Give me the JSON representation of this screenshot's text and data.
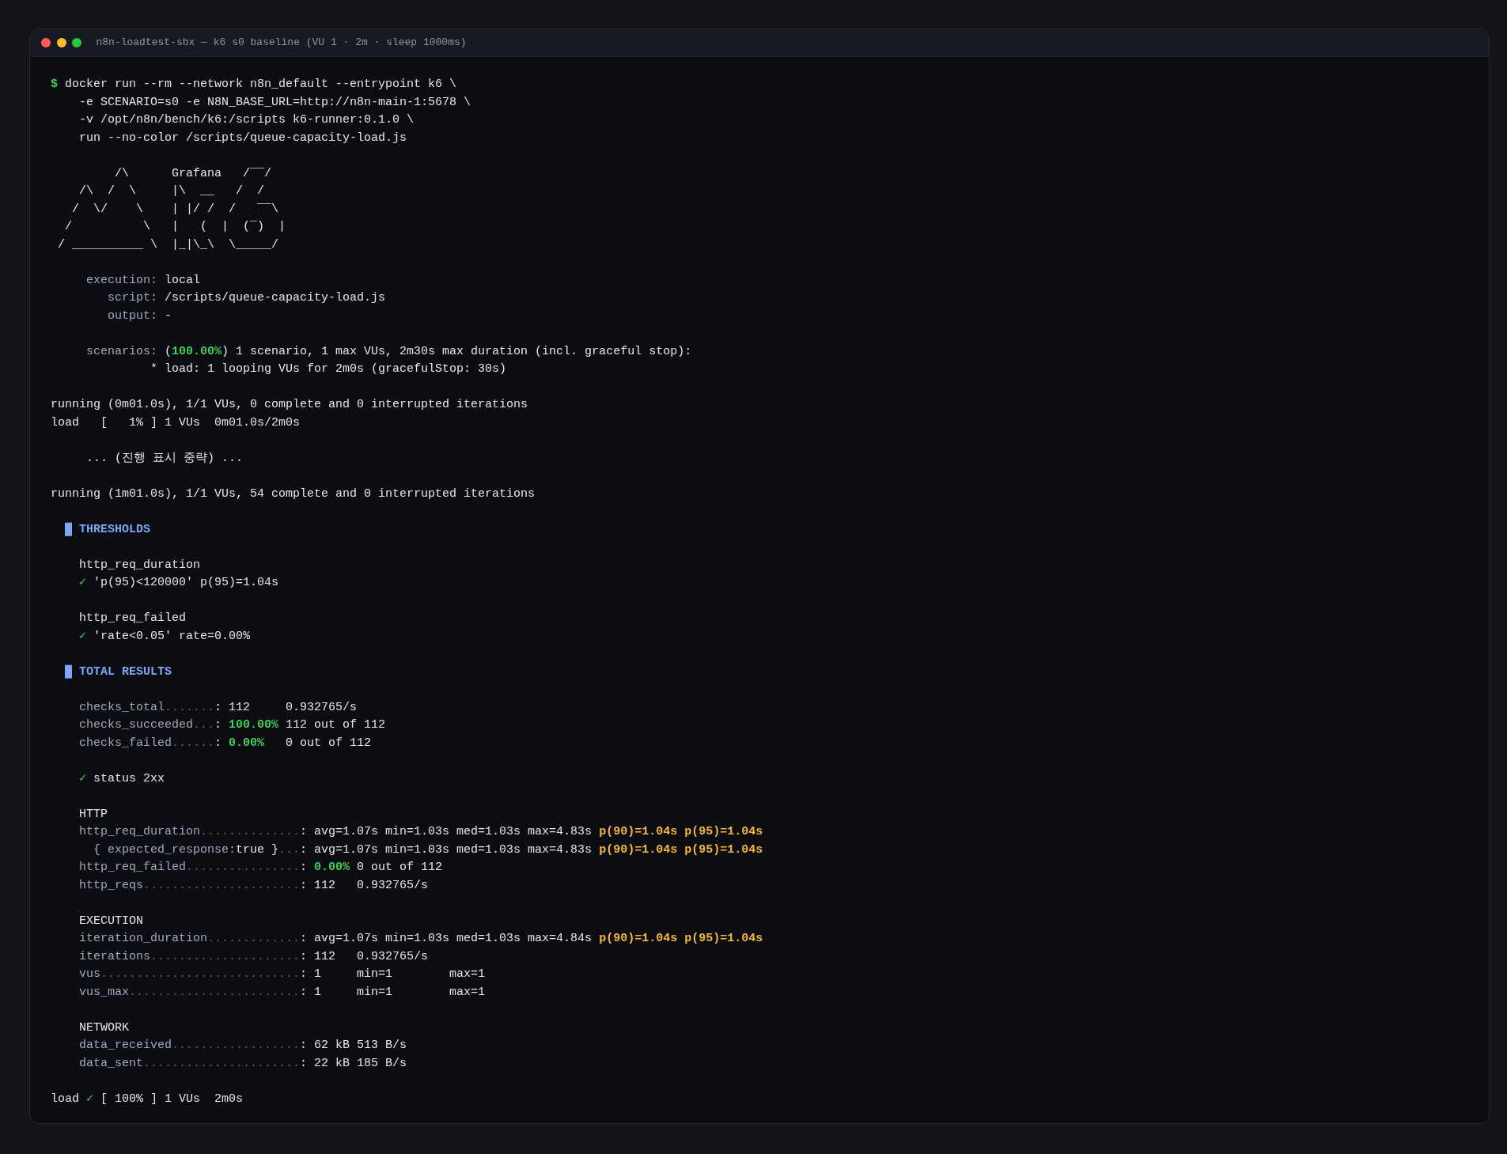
{
  "window": {
    "title": "n8n-loadtest-sbx — k6 s0 baseline (VU 1 · 2m · sleep 1000ms)"
  },
  "terminal": {
    "blocks": [
      {
        "kind": "text",
        "lines": [
          [
            {
              "text": "$",
              "kind": "prompt"
            },
            {
              "text": " docker run --rm --network n8n_default --entrypoint k6 \\",
              "kind": "plain"
            }
          ],
          [
            {
              "text": "    -e SCENARIO=s0 -e N8N_BASE_URL=http://n8n-main-1:5678 \\",
              "kind": "plain"
            }
          ],
          [
            {
              "text": "    -v /opt/n8n/bench/k6:/scripts k6-runner:0.1.0 \\",
              "kind": "plain"
            }
          ],
          [
            {
              "text": "    run --no-color /scripts/queue-capacity-load.js",
              "kind": "plain"
            }
          ]
        ]
      },
      {
        "kind": "art",
        "lines": [
          "         /\\      Grafana   /‾‾/",
          "    /\\  /  \\     |\\  __   /  /",
          "   /  \\/    \\    | |/ /  /   ‾‾\\",
          "  /          \\   |   (  |  (‾)  |",
          " / __________ \\  |_|\\_\\  \\_____/"
        ]
      },
      {
        "kind": "text",
        "lines": [
          [
            {
              "text": "     execution:",
              "kind": "label"
            },
            {
              "text": " local",
              "kind": "plain"
            }
          ],
          [
            {
              "text": "        script:",
              "kind": "label"
            },
            {
              "text": " /scripts/queue-capacity-load.js",
              "kind": "plain"
            }
          ],
          [
            {
              "text": "        output:",
              "kind": "label"
            },
            {
              "text": " -",
              "kind": "plain"
            }
          ]
        ]
      },
      {
        "kind": "text",
        "lines": [
          [
            {
              "text": "     scenarios:",
              "kind": "label"
            },
            {
              "text": " (",
              "kind": "plain"
            },
            {
              "text": "100.00%",
              "kind": "pass"
            },
            {
              "text": ") 1 scenario, 1 max VUs, 2m30s max duration (incl. graceful stop):",
              "kind": "plain"
            }
          ],
          [
            {
              "text": "              * load: 1 looping VUs for 2m0s (gracefulStop: 30s)",
              "kind": "plain"
            }
          ]
        ]
      },
      {
        "kind": "text",
        "lines": [
          [
            {
              "text": "running (0m01.0s), 1/1 VUs, 0 complete and 0 interrupted iterations",
              "kind": "plain"
            }
          ],
          [
            {
              "text": "load   [   1% ] 1 VUs  0m01.0s/2m0s",
              "kind": "plain"
            }
          ]
        ]
      },
      {
        "kind": "text",
        "lines": [
          [
            {
              "text": "     ... (진행 표시 중략) ...",
              "kind": "plain"
            }
          ]
        ]
      },
      {
        "kind": "text",
        "lines": [
          [
            {
              "text": "running (1m01.0s), 1/1 VUs, 54 complete and 0 interrupted iterations",
              "kind": "plain"
            }
          ]
        ]
      },
      {
        "kind": "text",
        "lines": [
          [
            {
              "text": "  █ THRESHOLDS",
              "kind": "heading"
            }
          ]
        ]
      },
      {
        "kind": "text",
        "lines": [
          [
            {
              "text": "    http_req_duration",
              "kind": "plain"
            }
          ],
          [
            {
              "text": "    ✓",
              "kind": "tick"
            },
            {
              "text": " 'p(95)<120000' p(95)=1.04s",
              "kind": "plain"
            }
          ]
        ]
      },
      {
        "kind": "text",
        "lines": [
          [
            {
              "text": "    http_req_failed",
              "kind": "plain"
            }
          ],
          [
            {
              "text": "    ✓",
              "kind": "tick"
            },
            {
              "text": " 'rate<0.05' rate=0.00%",
              "kind": "plain"
            }
          ]
        ]
      },
      {
        "kind": "text",
        "lines": [
          [
            {
              "text": "  █ TOTAL RESULTS",
              "kind": "heading"
            }
          ]
        ]
      },
      {
        "kind": "text",
        "lines": [
          [
            {
              "text": "    checks_total",
              "kind": "label"
            },
            {
              "text": ".......",
              "kind": "dots"
            },
            {
              "text": ": 112     0.932765/s",
              "kind": "plain"
            }
          ],
          [
            {
              "text": "    checks_succeeded",
              "kind": "label"
            },
            {
              "text": "...",
              "kind": "dots"
            },
            {
              "text": ": ",
              "kind": "plain"
            },
            {
              "text": "100.00%",
              "kind": "pass"
            },
            {
              "text": " 112 out of 112",
              "kind": "plain"
            }
          ],
          [
            {
              "text": "    checks_failed",
              "kind": "label"
            },
            {
              "text": "......",
              "kind": "dots"
            },
            {
              "text": ": ",
              "kind": "plain"
            },
            {
              "text": "0.00%",
              "kind": "pass"
            },
            {
              "text": "   0 out of 112",
              "kind": "plain"
            }
          ]
        ]
      },
      {
        "kind": "text",
        "lines": [
          [
            {
              "text": "    ✓",
              "kind": "tick"
            },
            {
              "text": " status 2xx",
              "kind": "plain"
            }
          ]
        ]
      },
      {
        "kind": "text",
        "lines": [
          [
            {
              "text": "    HTTP",
              "kind": "plain"
            }
          ],
          [
            {
              "text": "    http_req_duration",
              "kind": "label"
            },
            {
              "text": "..............",
              "kind": "dots"
            },
            {
              "text": ": avg=1.07s min=1.03s med=1.03s max=4.83s ",
              "kind": "plain"
            },
            {
              "text": "p(90)=1.04s p(95)=1.04s",
              "kind": "warn"
            }
          ],
          [
            {
              "text": "      { expected_response:",
              "kind": "label"
            },
            {
              "text": "true }",
              "kind": "plain"
            },
            {
              "text": "...",
              "kind": "dots"
            },
            {
              "text": ": avg=1.07s min=1.03s med=1.03s max=4.83s ",
              "kind": "plain"
            },
            {
              "text": "p(90)=1.04s p(95)=1.04s",
              "kind": "warn"
            }
          ],
          [
            {
              "text": "    http_req_failed",
              "kind": "label"
            },
            {
              "text": "................",
              "kind": "dots"
            },
            {
              "text": ": ",
              "kind": "plain"
            },
            {
              "text": "0.00%",
              "kind": "pass"
            },
            {
              "text": " 0 out of 112",
              "kind": "plain"
            }
          ],
          [
            {
              "text": "    http_reqs",
              "kind": "label"
            },
            {
              "text": "......................",
              "kind": "dots"
            },
            {
              "text": ": 112   0.932765/s",
              "kind": "plain"
            }
          ]
        ]
      },
      {
        "kind": "text",
        "lines": [
          [
            {
              "text": "    EXECUTION",
              "kind": "plain"
            }
          ],
          [
            {
              "text": "    iteration_duration",
              "kind": "label"
            },
            {
              "text": ".............",
              "kind": "dots"
            },
            {
              "text": ": avg=1.07s min=1.03s med=1.03s max=4.84s ",
              "kind": "plain"
            },
            {
              "text": "p(90)=1.04s p(95)=1.04s",
              "kind": "warn"
            }
          ],
          [
            {
              "text": "    iterations",
              "kind": "label"
            },
            {
              "text": ".....................",
              "kind": "dots"
            },
            {
              "text": ": 112   0.932765/s",
              "kind": "plain"
            }
          ],
          [
            {
              "text": "    vus",
              "kind": "label"
            },
            {
              "text": "............................",
              "kind": "dots"
            },
            {
              "text": ": 1     min=1        max=1",
              "kind": "plain"
            }
          ],
          [
            {
              "text": "    vus_max",
              "kind": "label"
            },
            {
              "text": "........................",
              "kind": "dots"
            },
            {
              "text": ": 1     min=1        max=1",
              "kind": "plain"
            }
          ]
        ]
      },
      {
        "kind": "text",
        "lines": [
          [
            {
              "text": "    NETWORK",
              "kind": "plain"
            }
          ],
          [
            {
              "text": "    data_received",
              "kind": "label"
            },
            {
              "text": "..................",
              "kind": "dots"
            },
            {
              "text": ": 62 kB 513 B/s",
              "kind": "plain"
            }
          ],
          [
            {
              "text": "    data_sent",
              "kind": "label"
            },
            {
              "text": "......................",
              "kind": "dots"
            },
            {
              "text": ": 22 kB 185 B/s",
              "kind": "plain"
            }
          ]
        ]
      },
      {
        "kind": "text",
        "lines": [
          [
            {
              "text": "load ",
              "kind": "plain"
            },
            {
              "text": "✓",
              "kind": "tick"
            },
            {
              "text": " [ 100% ] 1 VUs  2m0s",
              "kind": "plain"
            }
          ]
        ]
      }
    ]
  }
}
